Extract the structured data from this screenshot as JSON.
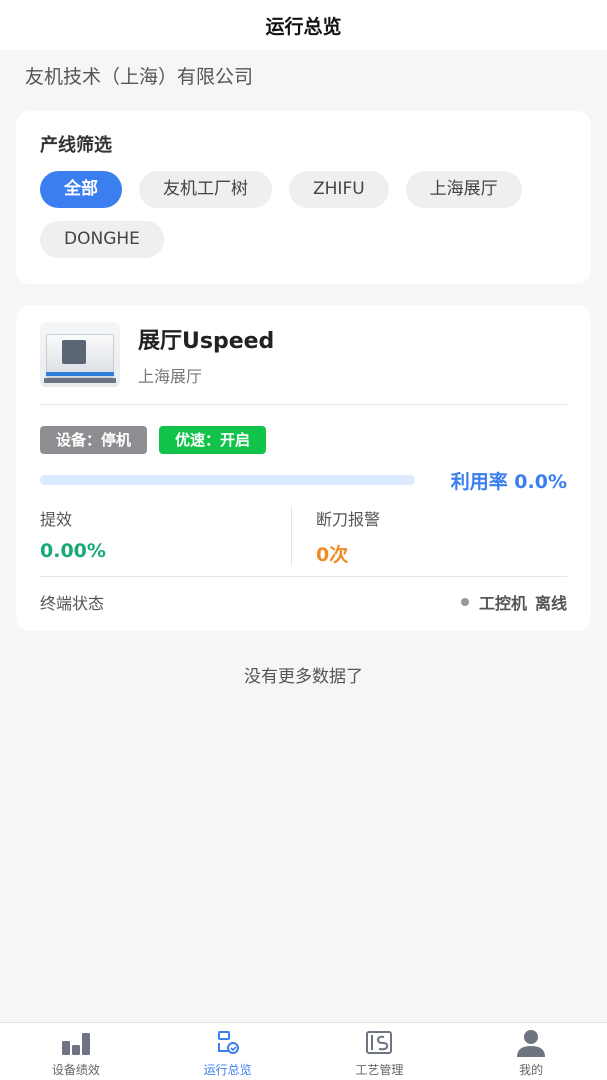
{
  "header": {
    "title": "运行总览"
  },
  "company": "友机技术（上海）有限公司",
  "filter": {
    "title": "产线筛选",
    "chips": [
      "全部",
      "友机工厂树",
      "ZHIFU",
      "上海展厅",
      "DONGHE"
    ],
    "active_index": 0
  },
  "device": {
    "name": "展厅Uspeed",
    "location": "上海展厅",
    "image_icon": "cnc-machine-icon",
    "tags": {
      "device_status": "设备：停机",
      "speed_status": "优速：开启"
    },
    "utilization": {
      "label": "利用率 0.0%",
      "value": 0.0
    },
    "stats": {
      "efficiency": {
        "label": "提效",
        "value": "0.00%"
      },
      "tool_break": {
        "label": "断刀报警",
        "value": "0次"
      }
    },
    "terminal": {
      "label": "终端状态",
      "name": "工控机",
      "status": "离线"
    }
  },
  "list_end": "没有更多数据了",
  "tabbar": [
    {
      "label": "设备绩效",
      "icon": "bar-chart-icon",
      "active": false
    },
    {
      "label": "运行总览",
      "icon": "overview-icon",
      "active": true
    },
    {
      "label": "工艺管理",
      "icon": "process-doc-icon",
      "active": false
    },
    {
      "label": "我的",
      "icon": "user-icon",
      "active": false
    }
  ],
  "colors": {
    "accent": "#3a7ef0",
    "success": "#12c34a",
    "efficiency_green": "#19a974",
    "alert_orange": "#f08a24",
    "offline_gray": "#999999"
  }
}
